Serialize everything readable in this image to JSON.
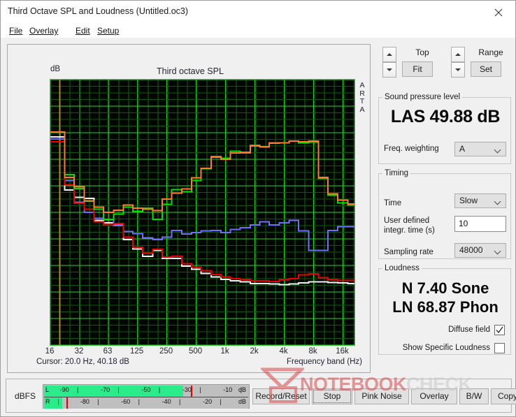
{
  "window": {
    "title": "Third Octave SPL and Loudness (Untitled.oc3)",
    "close_icon": "close-icon"
  },
  "menu": {
    "items": [
      {
        "label": "File",
        "mnemonic": "F"
      },
      {
        "label": "Overlay",
        "mnemonic": "O"
      },
      {
        "label": "Edit",
        "mnemonic": "E"
      },
      {
        "label": "Setup",
        "mnemonic": "S"
      }
    ]
  },
  "graph": {
    "title": "Third octave SPL",
    "y_unit": "dB",
    "x_axis_label": "Frequency band (Hz)",
    "cursor": "Cursor:   20.0 Hz, 40.18 dB",
    "watermark_vertical": "ARTA"
  },
  "controls": {
    "top": {
      "label": "Top",
      "button": "Fit"
    },
    "range": {
      "label": "Range",
      "button": "Set"
    },
    "spl": {
      "group": "Sound pressure level",
      "reading": "LAS 49.88 dB",
      "weighting_label": "Freq. weighting",
      "weighting_value": "A"
    },
    "timing": {
      "group": "Timing",
      "time_label": "Time",
      "time_value": "Slow",
      "user_label": "User defined integr. time (s)",
      "user_label_l1": "User defined",
      "user_label_l2": "integr. time (s)",
      "user_value": "10",
      "sampling_label": "Sampling rate",
      "sampling_value": "48000"
    },
    "loudness": {
      "group": "Loudness",
      "sone": "N 7.40 Sone",
      "phon": "LN 68.87 Phon",
      "diffuse_label": "Diffuse field",
      "diffuse_checked": true,
      "specific_label": "Show Specific Loudness",
      "specific_checked": false
    }
  },
  "bottom": {
    "dbfs_label": "dBFS",
    "meter": {
      "left_channel": "L",
      "right_channel": "R",
      "unit": "dB",
      "top_ticks": [
        "-90",
        "-70",
        "-50",
        "-30",
        "-10"
      ],
      "bottom_ticks": [
        "-80",
        "-60",
        "-40",
        "-20"
      ],
      "left_level_pct": 68,
      "right_level_pct": 9,
      "left_peak_pct": 72,
      "right_peak_pct": 11
    },
    "buttons": [
      {
        "label": "Record/Reset"
      },
      {
        "label": "Stop"
      },
      {
        "label": "Pink Noise"
      },
      {
        "label": "Overlay"
      },
      {
        "label": "B/W"
      },
      {
        "label": "Copy"
      }
    ]
  },
  "watermark": {
    "text_1": "NOTEBOOK",
    "text_2": "CHECK"
  },
  "chart_data": {
    "type": "line",
    "title": "Third octave SPL",
    "xlabel": "Frequency band (Hz)",
    "ylabel": "dB",
    "xscale": "log",
    "ylim": [
      0.0,
      50.0
    ],
    "ytick_step": 5.0,
    "yticks": [
      "0.0",
      "5.0",
      "10.0",
      "15.0",
      "20.0",
      "25.0",
      "30.0",
      "35.0",
      "40.0",
      "45.0",
      "50.0"
    ],
    "xticks": [
      "16",
      "32",
      "63",
      "125",
      "250",
      "500",
      "1k",
      "2k",
      "4k",
      "8k",
      "16k"
    ],
    "xtick_values": [
      16,
      32,
      63,
      125,
      250,
      500,
      1000,
      2000,
      4000,
      8000,
      16000
    ],
    "grid": true,
    "bg": "#000600",
    "grid_color": "#1f7a1f",
    "grid_major_color": "#2fcf2f",
    "cursor_marker": {
      "freq": 20.0,
      "level": 40.18,
      "color": "#b08a1e"
    },
    "bands": [
      16,
      20,
      25,
      31.5,
      40,
      50,
      63,
      80,
      100,
      125,
      160,
      200,
      250,
      315,
      400,
      500,
      630,
      800,
      1000,
      1250,
      1600,
      2000,
      2500,
      3150,
      4000,
      5000,
      6300,
      8000,
      10000,
      12500,
      16000,
      20000
    ],
    "series": [
      {
        "name": "green",
        "color": "#00e000",
        "values": [
          40.1,
          40.1,
          32.1,
          29.5,
          27.1,
          25.6,
          23.7,
          24.7,
          26.0,
          25.2,
          25.8,
          23.7,
          26.5,
          29.3,
          28.9,
          31.0,
          33.2,
          35.5,
          35.2,
          36.5,
          36.2,
          37.6,
          37.3,
          38.1,
          38.1,
          38.4,
          38.1,
          38.2,
          31.4,
          28.2,
          26.8,
          26.4
        ]
      },
      {
        "name": "orange",
        "color": "#ff7b28",
        "values": [
          40.1,
          40.1,
          31.6,
          29.8,
          27.2,
          26.0,
          25.0,
          25.4,
          26.4,
          25.8,
          25.6,
          25.3,
          27.5,
          28.6,
          29.4,
          31.5,
          33.3,
          35.4,
          35.0,
          36.2,
          36.3,
          37.5,
          37.4,
          38.0,
          38.1,
          38.4,
          38.3,
          38.4,
          31.6,
          28.5,
          27.3,
          26.6
        ]
      },
      {
        "name": "white",
        "color": "#f2f2f2",
        "values": [
          39.2,
          39.2,
          29.2,
          27.8,
          27.6,
          23.5,
          23.0,
          22.8,
          19.9,
          18.1,
          16.7,
          17.8,
          16.3,
          16.3,
          14.9,
          14.3,
          13.5,
          12.8,
          12.4,
          12.1,
          11.9,
          11.6,
          11.6,
          11.5,
          11.4,
          11.5,
          11.7,
          11.9,
          11.9,
          11.8,
          11.7,
          11.6
        ]
      },
      {
        "name": "blue",
        "color": "#6e6eff",
        "values": [
          38.8,
          38.8,
          31.0,
          26.9,
          25.0,
          23.9,
          23.6,
          22.5,
          21.4,
          21.0,
          20.2,
          19.9,
          20.3,
          21.6,
          20.9,
          21.2,
          21.5,
          21.6,
          21.2,
          21.8,
          22.1,
          22.6,
          23.2,
          22.6,
          23.0,
          23.5,
          21.5,
          17.8,
          17.8,
          21.6,
          22.3,
          22.3
        ]
      },
      {
        "name": "red",
        "color": "#ee0000",
        "values": [
          38.3,
          38.3,
          30.2,
          26.7,
          25.6,
          23.2,
          22.7,
          22.9,
          20.3,
          18.4,
          17.3,
          18.0,
          16.6,
          16.7,
          15.3,
          14.7,
          14.0,
          13.3,
          12.8,
          12.5,
          12.3,
          12.1,
          12.1,
          12.0,
          12.3,
          12.5,
          13.2,
          13.4,
          12.7,
          12.3,
          12.2,
          12.2
        ]
      }
    ]
  }
}
